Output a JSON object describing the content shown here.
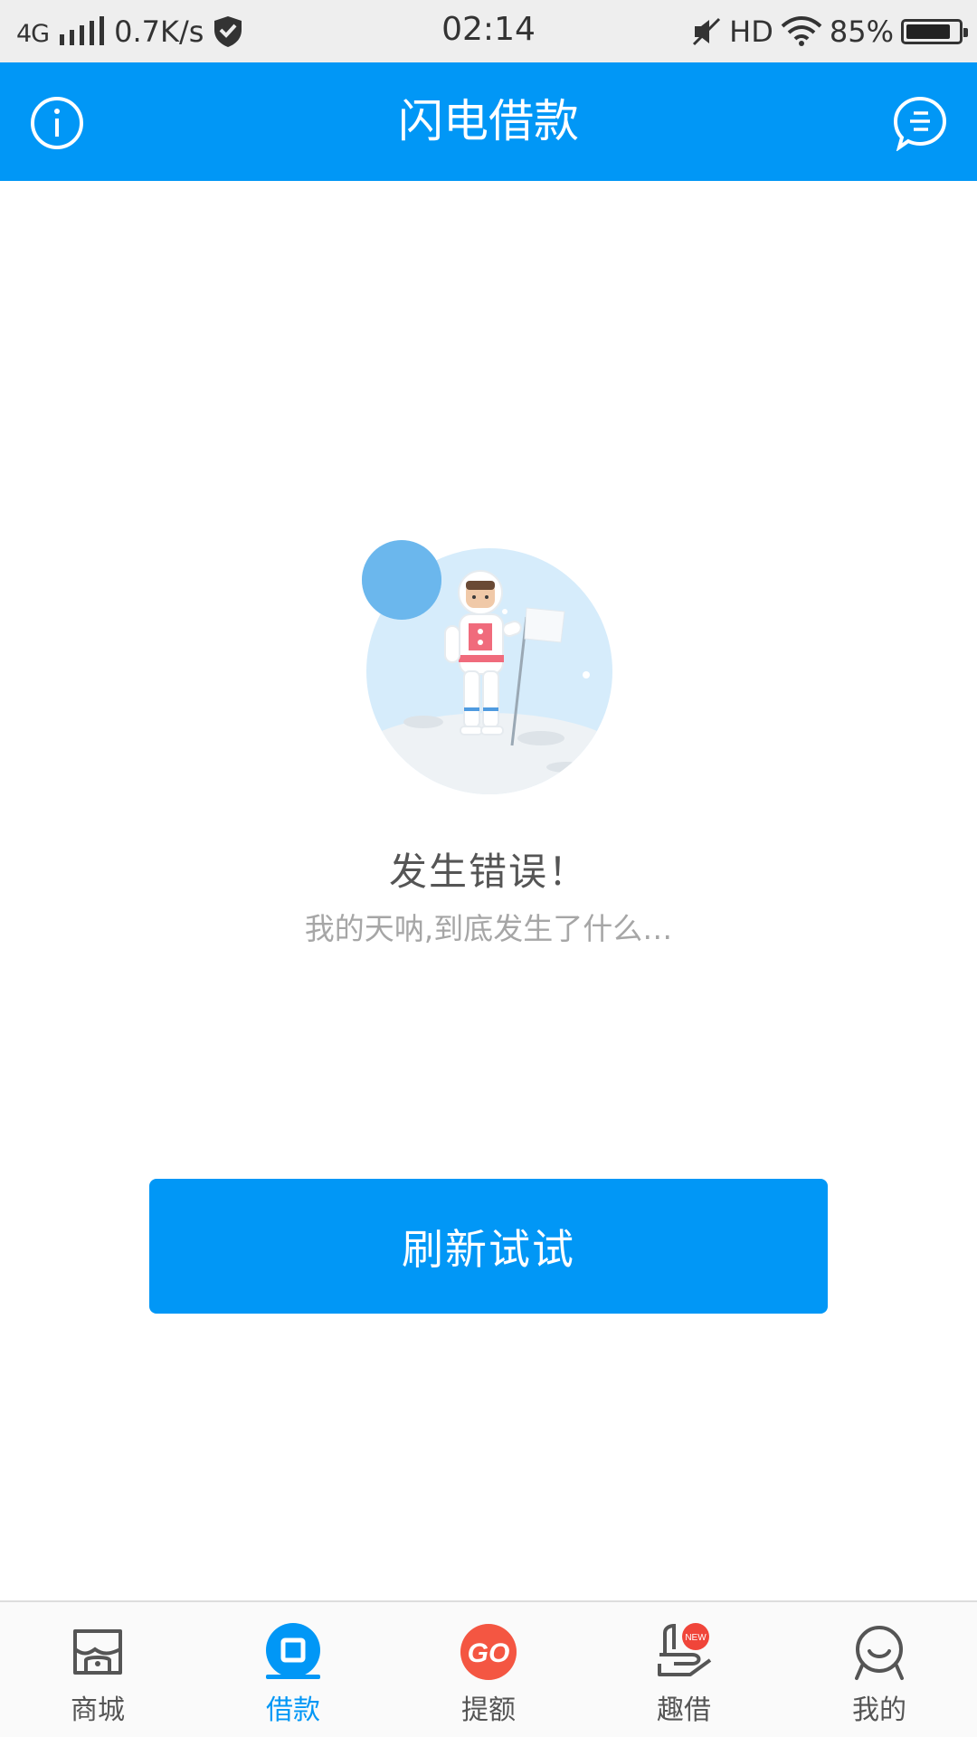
{
  "status_bar": {
    "network": "4G",
    "speed": "0.7K/s",
    "time": "02:14",
    "hd": "HD",
    "battery": "85%",
    "battery_level": 0.85
  },
  "header": {
    "title": "闪电借款",
    "left_icon": "info-icon",
    "right_icon": "message-icon"
  },
  "error": {
    "title": "发生错误！",
    "subtitle": "我的天呐,到底发生了什么…",
    "illustration": "astronaut-illustration"
  },
  "refresh_button": {
    "label": "刷新试试"
  },
  "bottom_nav": {
    "items": [
      {
        "label": "商城",
        "icon": "store-icon",
        "active": false
      },
      {
        "label": "借款",
        "icon": "loan-icon",
        "active": true
      },
      {
        "label": "提额",
        "icon": "go-icon",
        "active": false
      },
      {
        "label": "趣借",
        "icon": "hand-icon",
        "active": false,
        "badge": "NEW"
      },
      {
        "label": "我的",
        "icon": "profile-icon",
        "active": false
      }
    ]
  },
  "colors": {
    "primary": "#0197f6",
    "status_bar_bg": "#eeeeee",
    "text_dark": "#555555",
    "text_light": "#a6a6a6",
    "go_red": "#f0453a"
  }
}
